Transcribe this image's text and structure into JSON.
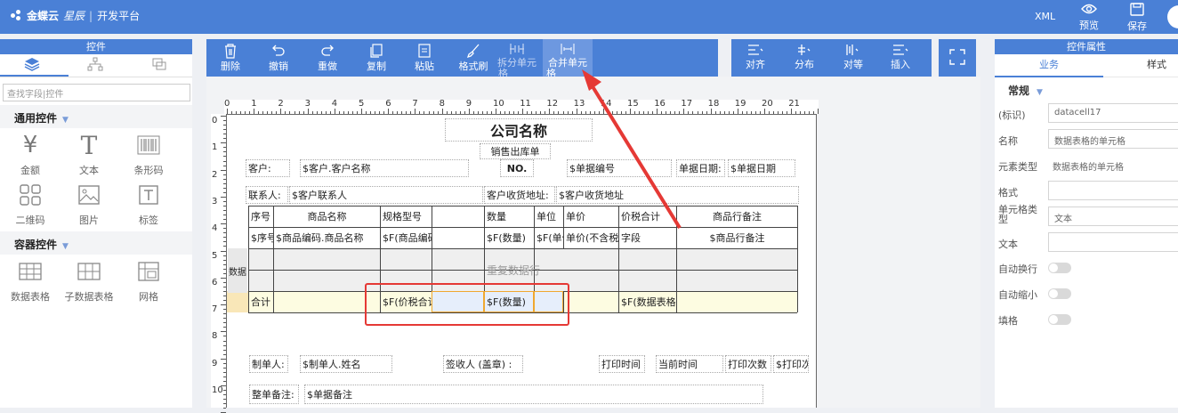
{
  "header": {
    "logo_brand": "金蝶云",
    "logo_product": "星辰",
    "logo_separator": "|",
    "logo_platform": "开发平台",
    "xml_label": "XML",
    "preview_label": "预览",
    "save_label": "保存"
  },
  "left_panel": {
    "title": "控件",
    "search_placeholder": "查找字段|控件",
    "groups": [
      {
        "title": "通用控件",
        "items": [
          {
            "label": "金额"
          },
          {
            "label": "文本"
          },
          {
            "label": "条形码"
          },
          {
            "label": "二维码"
          },
          {
            "label": "图片"
          },
          {
            "label": "标签"
          }
        ]
      },
      {
        "title": "容器控件",
        "items": [
          {
            "label": "数据表格"
          },
          {
            "label": "子数据表格"
          },
          {
            "label": "网格"
          }
        ]
      }
    ]
  },
  "toolbar": {
    "left_buttons": [
      {
        "label": "删除",
        "icon": "trash-icon"
      },
      {
        "label": "撤销",
        "icon": "undo-icon"
      },
      {
        "label": "重做",
        "icon": "redo-icon"
      },
      {
        "label": "复制",
        "icon": "copy-icon"
      },
      {
        "label": "粘贴",
        "icon": "paste-icon"
      },
      {
        "label": "格式刷",
        "icon": "brush-icon"
      },
      {
        "label": "拆分单元格",
        "icon": "split-cell-icon",
        "line1": "拆分单元",
        "line2": "格"
      },
      {
        "label": "合并单元格",
        "icon": "merge-cell-icon",
        "line1": "合并单元",
        "line2": "格"
      }
    ],
    "right_buttons": [
      {
        "label": "对齐",
        "icon": "align-icon"
      },
      {
        "label": "分布",
        "icon": "distribute-icon"
      },
      {
        "label": "对等",
        "icon": "equal-size-icon"
      },
      {
        "label": "插入",
        "icon": "insert-icon"
      }
    ],
    "fullscreen_icon": "fullscreen-icon"
  },
  "ruler": {
    "h_ticks": [
      "0",
      "1",
      "2",
      "3",
      "4",
      "5",
      "6",
      "7",
      "8",
      "9",
      "10",
      "11",
      "12",
      "13",
      "14",
      "15",
      "16",
      "17",
      "18",
      "19",
      "20",
      "21"
    ],
    "v_ticks": [
      "0",
      "1",
      "2",
      "3",
      "4",
      "5",
      "6",
      "7",
      "8",
      "9",
      "10"
    ]
  },
  "report": {
    "company_name": "公司名称",
    "doc_type": "销售出库单",
    "customer_label": "客户:",
    "customer_value": "$客户.客户名称",
    "no_label": "NO.",
    "bill_no": "$单据编号",
    "bill_date_label": "单据日期:",
    "bill_date": "$单据日期",
    "contact_label": "联系人:",
    "contact_value": "$客户联系人",
    "address_label": "客户收货地址:",
    "address_value": "$客户收货地址",
    "table_headers": [
      "序号",
      "商品名称",
      "规格型号",
      "",
      "数量",
      "单位",
      "单价",
      "价税合计",
      "商品行备注"
    ],
    "table_row": [
      "$序号",
      "$商品编码.商品名称",
      "$F(商品编码.规格型号)",
      "",
      "$F(数量)",
      "$F(单位",
      "单价(不含税)",
      "字段",
      "$商品行备注"
    ],
    "repeat_row_label": "重复数据行",
    "side_label": "数据",
    "total_label": "合计",
    "total_tax": "$F(价税合计",
    "total_qty": "$F(数量)",
    "total_table": "$F(数据表格的",
    "maker_label": "制单人:",
    "maker_value": "$制单人.姓名",
    "signer_label": "签收人 (盖章) :",
    "print_time": "打印时间",
    "current_time": "当前时间",
    "print_count": "打印次数",
    "print_func": "$打印次",
    "remark_label": "整单备注:",
    "remark_value": "$单据备注"
  },
  "right_panel": {
    "title": "控件属性",
    "tabs": [
      "业务",
      "样式"
    ],
    "section": "常规",
    "props": [
      {
        "label": "(标识)",
        "value": "datacell17",
        "type": "input"
      },
      {
        "label": "名称",
        "value": "数据表格的单元格",
        "type": "input"
      },
      {
        "label": "元素类型",
        "value": "数据表格的单元格",
        "type": "text"
      },
      {
        "label": "格式",
        "value": "",
        "type": "input"
      },
      {
        "label": "单元格类型",
        "value": "文本",
        "type": "input",
        "line1": "单元格类",
        "line2": "型"
      },
      {
        "label": "文本",
        "value": "",
        "type": "input"
      },
      {
        "label": "自动换行",
        "type": "toggle"
      },
      {
        "label": "自动缩小",
        "type": "toggle"
      },
      {
        "label": "填格",
        "type": "toggle"
      }
    ]
  },
  "colors": {
    "primary": "#4a80d6",
    "highlight_red": "#e53935",
    "total_row": "#fdfce1"
  }
}
